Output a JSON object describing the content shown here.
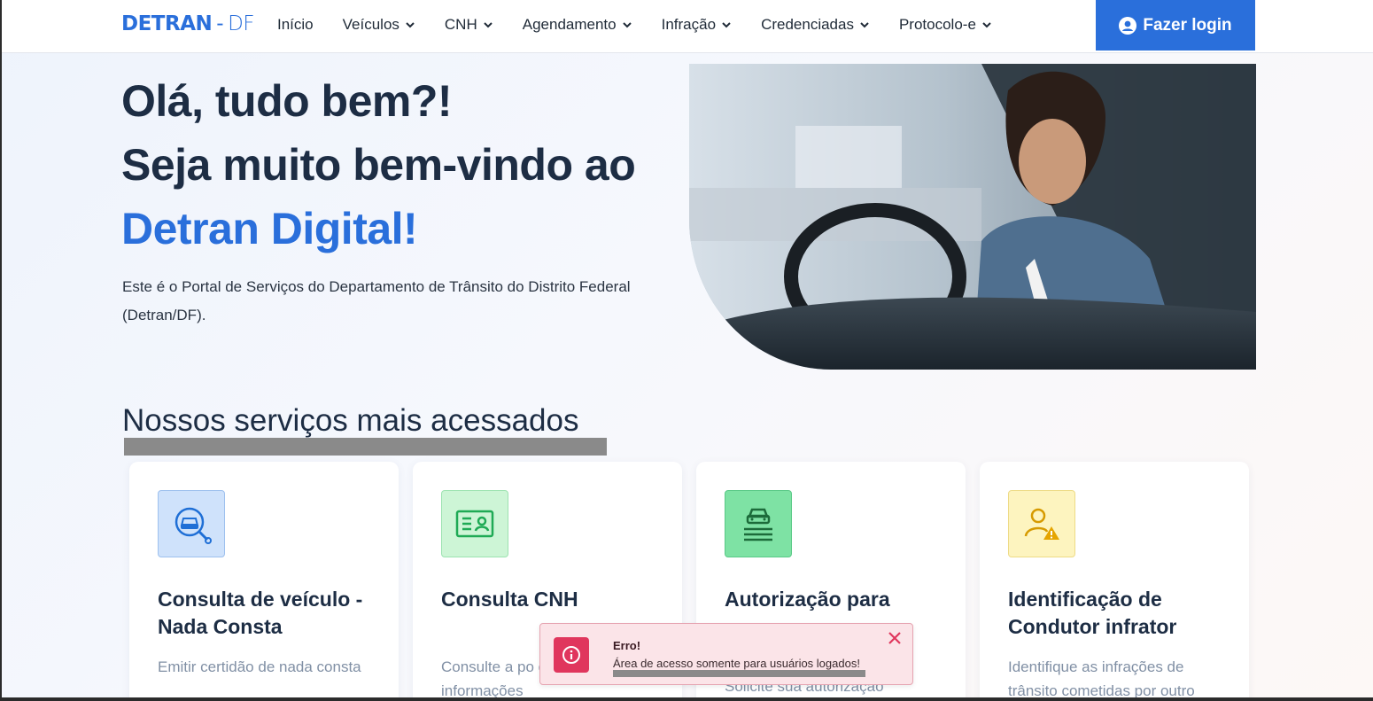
{
  "brand": {
    "main": "DETRAN",
    "sep": "-",
    "suffix": "DF",
    "color": "#2a6fdb"
  },
  "nav": {
    "items": [
      {
        "label": "Início",
        "dropdown": false
      },
      {
        "label": "Veículos",
        "dropdown": true
      },
      {
        "label": "CNH",
        "dropdown": true
      },
      {
        "label": "Agendamento",
        "dropdown": true
      },
      {
        "label": "Infração",
        "dropdown": true
      },
      {
        "label": "Credenciadas",
        "dropdown": true
      },
      {
        "label": "Protocolo-e",
        "dropdown": true
      }
    ],
    "login_label": "Fazer login",
    "login_icon": "user-circle-icon"
  },
  "hero": {
    "line1": "Olá, tudo bem?!",
    "line2": "Seja muito bem-vindo ao",
    "line3": "Detran Digital!",
    "description": "Este é o Portal de Serviços do Departamento de Trânsito do Distrito Federal (Detran/DF)."
  },
  "services": {
    "title": "Nossos serviços mais acessados",
    "cards": [
      {
        "title": "Consulta de veículo - Nada Consta",
        "desc": "Emitir certidão de nada consta",
        "icon": "car-search-icon",
        "bg": "#cfe2fb"
      },
      {
        "title": "Consulta CNH",
        "desc": "Consulte a po carteira de mo informações",
        "icon": "id-card-icon",
        "bg": "#cdf5d6"
      },
      {
        "title": "Autorização para",
        "desc": "Solicite sua autorização",
        "icon": "car-document-icon",
        "bg": "#7ee2a4"
      },
      {
        "title": "Identificação de Condutor infrator",
        "desc": "Identifique as infrações de trânsito cometidas por outro",
        "icon": "user-warning-icon",
        "bg": "#fdf4bf"
      }
    ]
  },
  "toast": {
    "title": "Erro!",
    "message": "Área de acesso somente para usuários logados!",
    "icon": "info-icon",
    "color": "#e0365d"
  }
}
